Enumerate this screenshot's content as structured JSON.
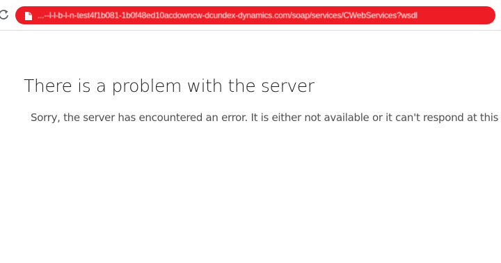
{
  "browser": {
    "reload_icon": "reload-icon",
    "page_info_icon": "page-info-icon",
    "address_bar_color": "#ee1c25",
    "url": "...--l-l-b-l-n-test4f1b081-1b0f48ed10acdowncw-dcundex-dynamics.com/soap/services/CWebServices?wsdl"
  },
  "page": {
    "title": "There is a problem with the server",
    "message": "Sorry, the server has encountered an error. It is either not available or it can't respond at this time."
  }
}
